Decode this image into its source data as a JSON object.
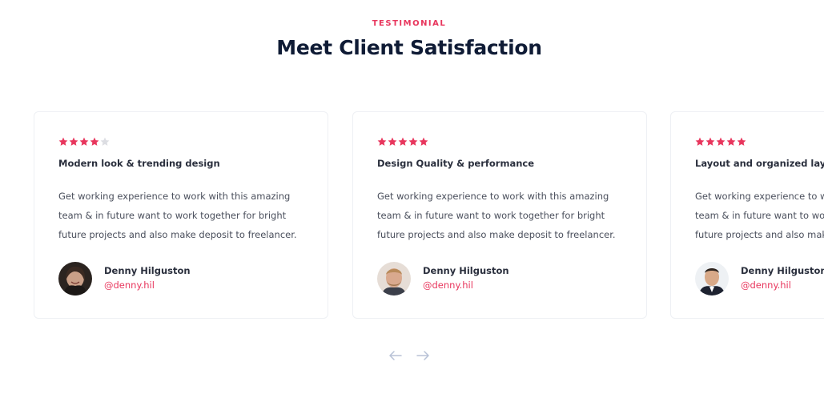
{
  "section": {
    "eyebrow": "TESTIMONIAL",
    "title": "Meet Client Satisfaction"
  },
  "colors": {
    "accent": "#e8365d",
    "title": "#0f1b35",
    "star_filled": "#e8365d",
    "star_empty": "#dcdde2",
    "nav_arrow": "#b8c2d6"
  },
  "testimonials": [
    {
      "rating": 4,
      "max_rating": 5,
      "title": "Modern look & trending design",
      "body": "Get working experience to work with this amazing team & in future want to work together for bright future projects and also make deposit to freelancer.",
      "name": "Denny Hilguston",
      "handle": "@denny.hil",
      "avatar_icon": "avatar-woman"
    },
    {
      "rating": 5,
      "max_rating": 5,
      "title": "Design Quality & performance",
      "body": "Get working experience to work with this amazing team & in future want to work together for bright future projects and also make deposit to freelancer.",
      "name": "Denny Hilguston",
      "handle": "@denny.hil",
      "avatar_icon": "avatar-man-beard"
    },
    {
      "rating": 5,
      "max_rating": 5,
      "title": "Layout and organized layers",
      "body": "Get working experience to work with this amazing team & in future want to work together for bright future projects and also make deposit to freelancer.",
      "name": "Denny Hilguston",
      "handle": "@denny.hil",
      "avatar_icon": "avatar-man-suit"
    }
  ],
  "nav": {
    "prev_icon": "arrow-left-icon",
    "next_icon": "arrow-right-icon"
  }
}
